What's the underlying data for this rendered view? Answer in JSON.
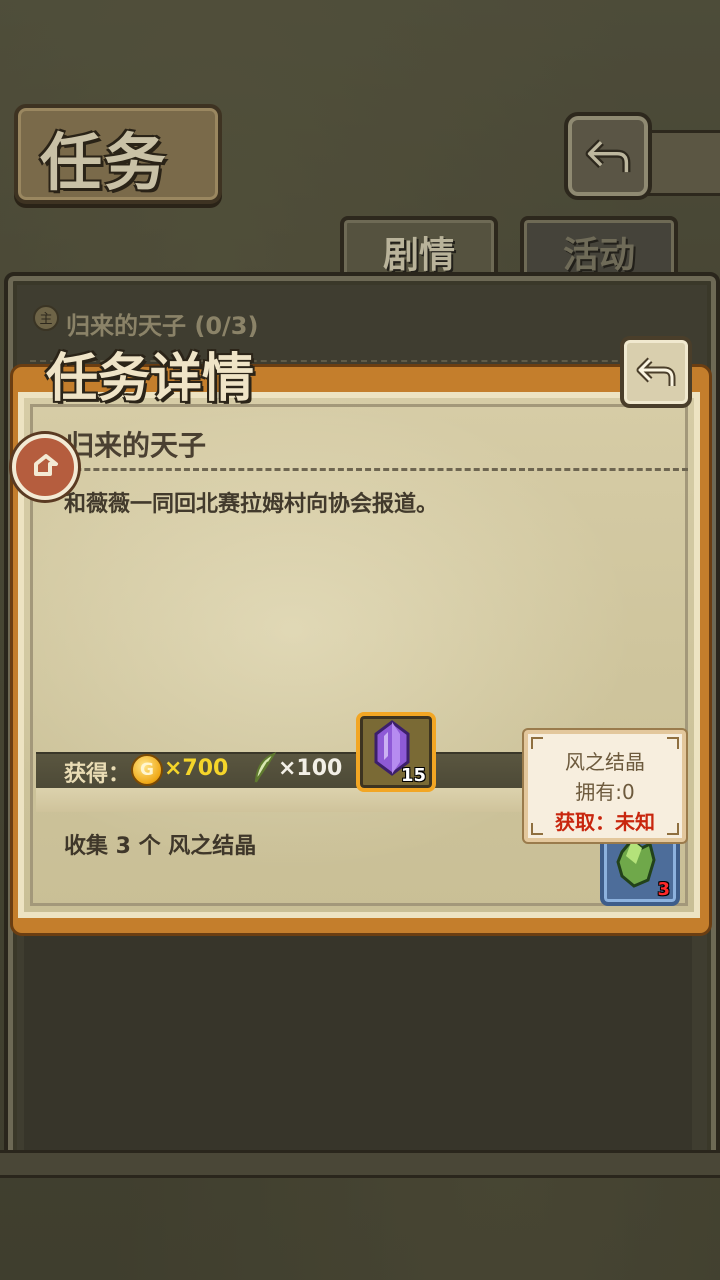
{
  "header": {
    "title": "任务"
  },
  "tabs": [
    {
      "label": "剧情",
      "active": true
    },
    {
      "label": "活动",
      "active": false
    }
  ],
  "quest_list": {
    "first_item": "归来的天子 (0/3)"
  },
  "dialog": {
    "title": "任务详情",
    "task_name": "归来的天子",
    "description": "和薇薇一同回北赛拉姆村向协会报道。",
    "reward_label": "获得：",
    "gold": "×700",
    "feather": "×100",
    "crystal_count": "15",
    "objective": "收集 3 个 风之结晶",
    "objective_item_count": "3"
  },
  "tooltip": {
    "name": "风之结晶",
    "owned": "拥有:0",
    "source": "获取：未知"
  },
  "icons": {
    "gold_coin_letter": "G"
  },
  "colors": {
    "dialog_frame": "#c47e2c",
    "gold_text": "#f5d52a",
    "tooltip_source": "#c8260e"
  }
}
